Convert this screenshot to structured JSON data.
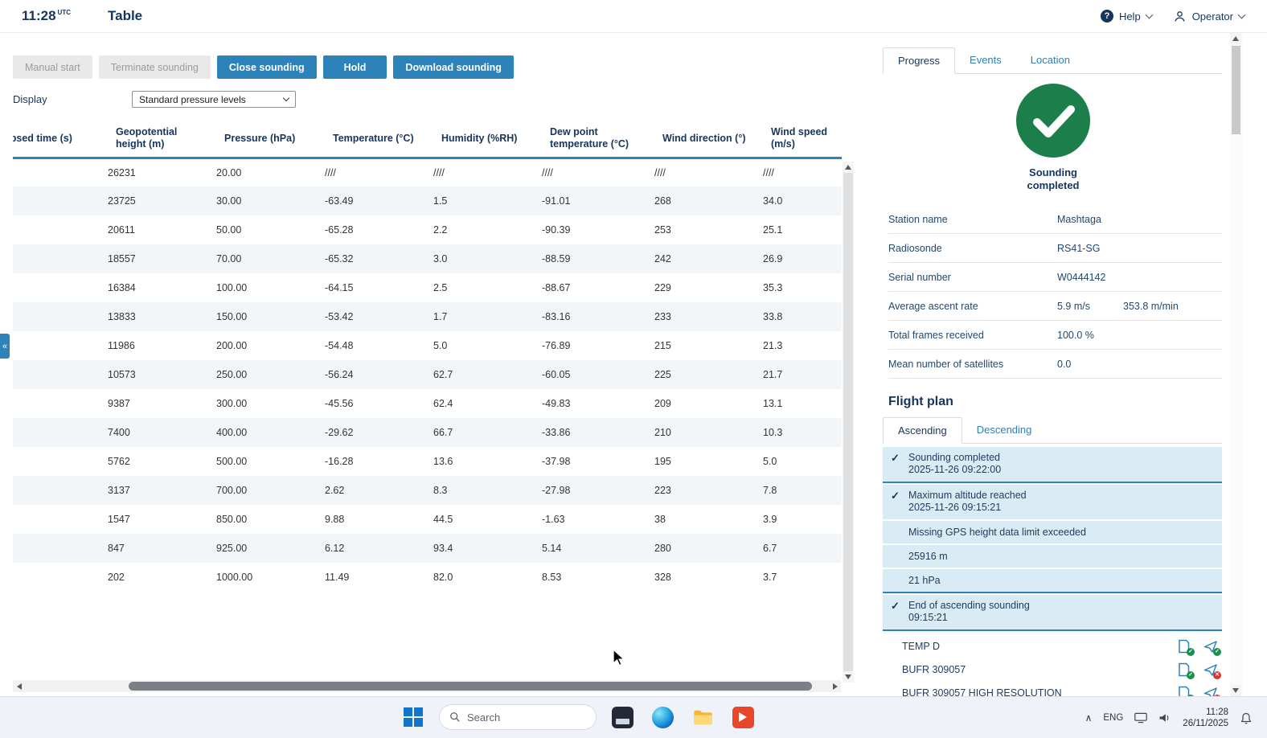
{
  "topbar": {
    "time": "11:28",
    "time_suffix": "UTC",
    "title": "Table",
    "help_label": "Help",
    "operator_label": "Operator"
  },
  "toolbar": {
    "manual_start": "Manual start",
    "terminate_sounding": "Terminate sounding",
    "close_sounding": "Close sounding",
    "hold": "Hold",
    "download_sounding": "Download sounding"
  },
  "display": {
    "label": "Display",
    "selected_option": "Standard pressure levels"
  },
  "table": {
    "columns": [
      "Elapsed time (s)",
      "Geopotential height (m)",
      "Pressure (hPa)",
      "Temperature (°C)",
      "Humidity (%RH)",
      "Dew point temperature (°C)",
      "Wind direction (°)",
      "Wind speed (m/s)"
    ],
    "rows": [
      [
        "",
        "26231",
        "20.00",
        "////",
        "////",
        "////",
        "////",
        "////"
      ],
      [
        "",
        "23725",
        "30.00",
        "-63.49",
        "1.5",
        "-91.01",
        "268",
        "34.0"
      ],
      [
        "",
        "20611",
        "50.00",
        "-65.28",
        "2.2",
        "-90.39",
        "253",
        "25.1"
      ],
      [
        "",
        "18557",
        "70.00",
        "-65.32",
        "3.0",
        "-88.59",
        "242",
        "26.9"
      ],
      [
        "",
        "16384",
        "100.00",
        "-64.15",
        "2.5",
        "-88.67",
        "229",
        "35.3"
      ],
      [
        "",
        "13833",
        "150.00",
        "-53.42",
        "1.7",
        "-83.16",
        "233",
        "33.8"
      ],
      [
        "",
        "11986",
        "200.00",
        "-54.48",
        "5.0",
        "-76.89",
        "215",
        "21.3"
      ],
      [
        "",
        "10573",
        "250.00",
        "-56.24",
        "62.7",
        "-60.05",
        "225",
        "21.7"
      ],
      [
        "",
        "9387",
        "300.00",
        "-45.56",
        "62.4",
        "-49.83",
        "209",
        "13.1"
      ],
      [
        "",
        "7400",
        "400.00",
        "-29.62",
        "66.7",
        "-33.86",
        "210",
        "10.3"
      ],
      [
        "",
        "5762",
        "500.00",
        "-16.28",
        "13.6",
        "-37.98",
        "195",
        "5.0"
      ],
      [
        "",
        "3137",
        "700.00",
        "2.62",
        "8.3",
        "-27.98",
        "223",
        "7.8"
      ],
      [
        "",
        "1547",
        "850.00",
        "9.88",
        "44.5",
        "-1.63",
        "38",
        "3.9"
      ],
      [
        "",
        "847",
        "925.00",
        "6.12",
        "93.4",
        "5.14",
        "280",
        "6.7"
      ],
      [
        "",
        "202",
        "1000.00",
        "11.49",
        "82.0",
        "8.53",
        "328",
        "3.7"
      ]
    ]
  },
  "panel": {
    "tabs": [
      "Progress",
      "Events",
      "Location"
    ],
    "status_text": "Sounding completed",
    "info": [
      {
        "label": "Station name",
        "value": "Mashtaga",
        "value2": ""
      },
      {
        "label": "Radiosonde",
        "value": "RS41-SG",
        "value2": ""
      },
      {
        "label": "Serial number",
        "value": "W0444142",
        "value2": ""
      },
      {
        "label": "Average ascent rate",
        "value": "5.9 m/s",
        "value2": "353.8 m/min"
      },
      {
        "label": "Total frames received",
        "value": "100.0 %",
        "value2": ""
      },
      {
        "label": "Mean number of satellites",
        "value": "0.0",
        "value2": ""
      }
    ],
    "flight_plan_title": "Flight plan",
    "flight_tabs": [
      "Ascending",
      "Descending"
    ],
    "events": [
      {
        "title": "Sounding completed",
        "time": "2025-11-26 09:22:00"
      },
      {
        "title": "Maximum altitude reached",
        "time": "2025-11-26 09:15:21",
        "details": [
          "Missing GPS height data limit exceeded",
          "25916 m",
          "21 hPa"
        ]
      },
      {
        "title": "End of ascending sounding",
        "time": "09:15:21"
      }
    ],
    "messages": [
      {
        "label": "TEMP D",
        "status": "sent-ok"
      },
      {
        "label": "BUFR 309057",
        "status": "send-failed"
      },
      {
        "label": "BUFR 309057 HIGH RESOLUTION",
        "status": "send-failed"
      },
      {
        "label": "",
        "status": "sent-ok"
      }
    ]
  },
  "taskbar": {
    "search_placeholder": "Search",
    "tray_lang": "ENG",
    "time": "11:28",
    "date": "26/11/2025"
  },
  "colors": {
    "accent_blue": "#2e82ba",
    "success_green": "#1c7e4b",
    "error_red": "#d6342c",
    "navy_text": "#16355c"
  }
}
